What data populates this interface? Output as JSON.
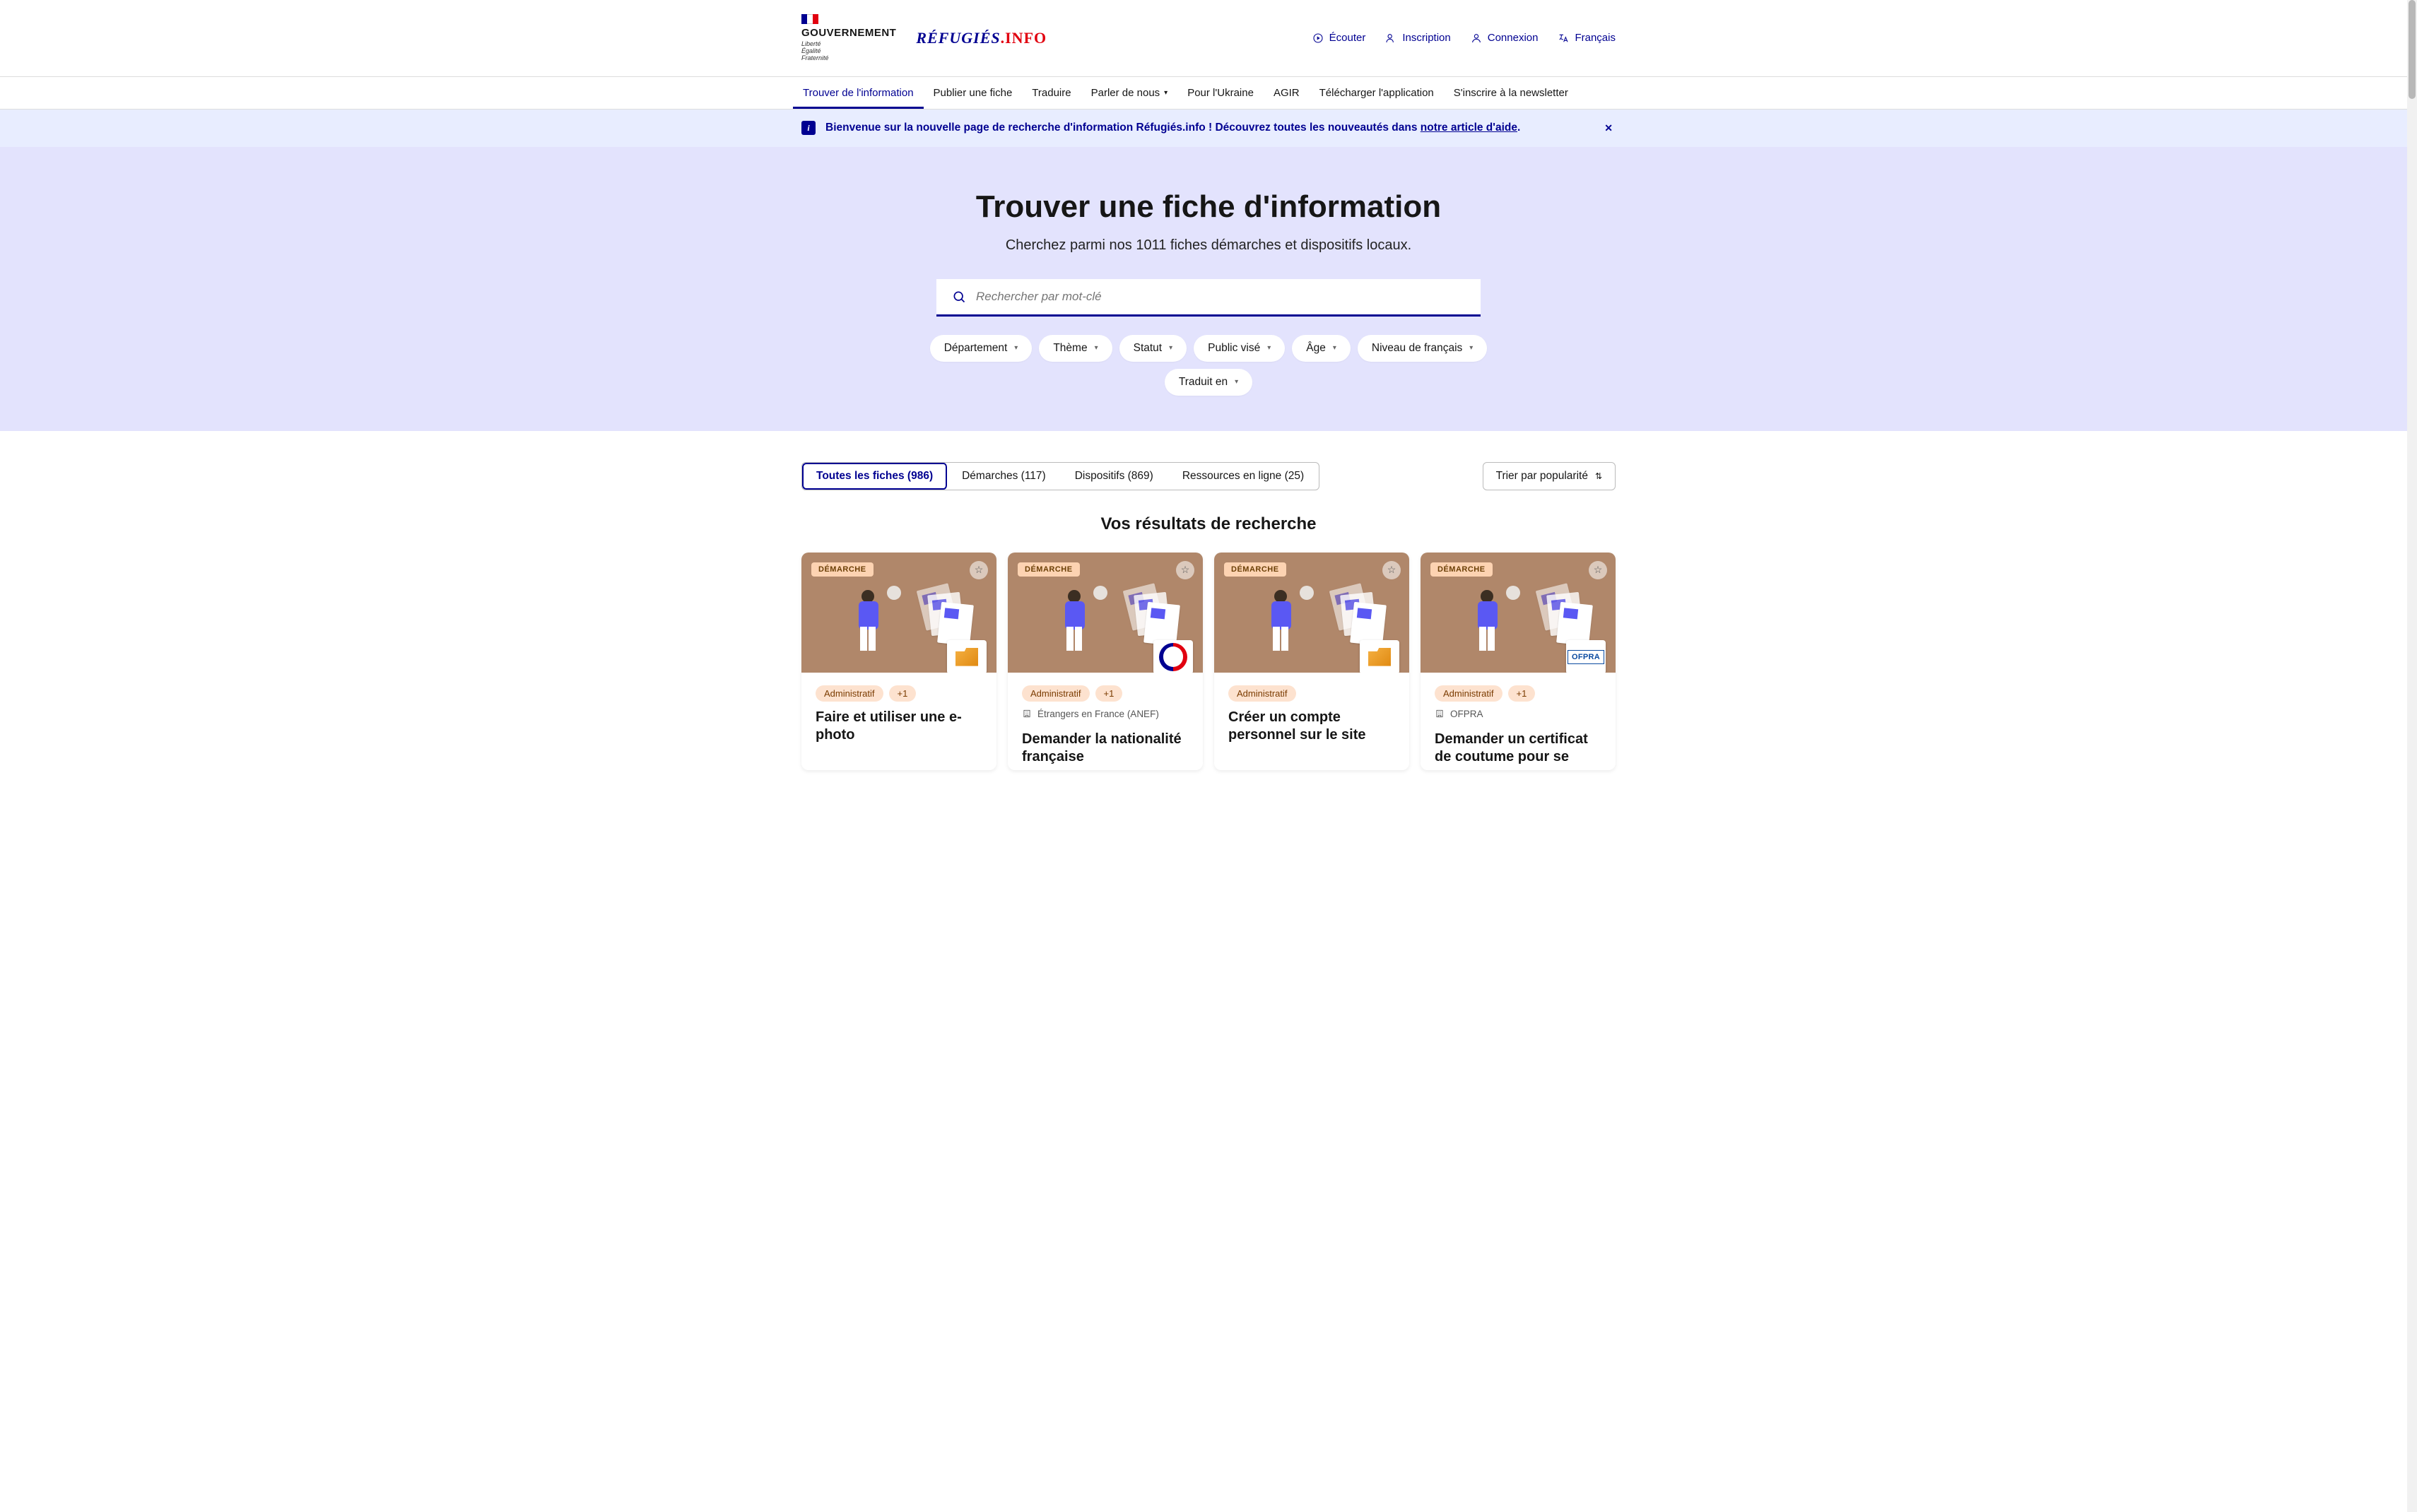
{
  "header": {
    "gov_word": "GOUVERNEMENT",
    "gov_motto": "Liberté\nÉgalité\nFraternité",
    "logo_a": "RÉFUGIÉS",
    "logo_b": ".INFO",
    "actions": {
      "listen": "Écouter",
      "register": "Inscription",
      "login": "Connexion",
      "language": "Français"
    }
  },
  "nav": {
    "find": "Trouver de l'information",
    "publish": "Publier une fiche",
    "translate": "Traduire",
    "talk": "Parler de nous",
    "ukraine": "Pour l'Ukraine",
    "agir": "AGIR",
    "download": "Télécharger l'application",
    "newsletter": "S'inscrire à la newsletter"
  },
  "banner": {
    "text_before": "Bienvenue sur la nouvelle page de recherche d'information Réfugiés.info ! Découvrez toutes les nouveautés dans ",
    "link": "notre article d'aide",
    "text_after": "."
  },
  "hero": {
    "title": "Trouver une fiche d'information",
    "subtitle": "Cherchez parmi nos 1011 fiches démarches et dispositifs locaux.",
    "search_placeholder": "Rechercher par mot-clé",
    "filters": {
      "department": "Département",
      "theme": "Thème",
      "status": "Statut",
      "audience": "Public visé",
      "age": "Âge",
      "french_level": "Niveau de français",
      "translated": "Traduit en"
    }
  },
  "tabs": {
    "all": "Toutes les fiches (986)",
    "steps": "Démarches (117)",
    "devices": "Dispositifs (869)",
    "online": "Ressources en ligne (25)"
  },
  "sort_label": "Trier par popularité",
  "results_heading": "Vos résultats de recherche",
  "card_badge": "DÉMARCHE",
  "tags": {
    "admin": "Administratif",
    "plus1": "+1"
  },
  "org_names": {
    "anef": "Étrangers en France (ANEF)",
    "ofpra": "OFPRA"
  },
  "cards": [
    {
      "title": "Faire et utiliser une e-photo",
      "org_logo": "folder",
      "tags": [
        "admin",
        "plus1"
      ]
    },
    {
      "title": "Demander la nationalité française",
      "org_logo": "marianne",
      "org_line": "anef",
      "tags": [
        "admin",
        "plus1"
      ]
    },
    {
      "title": "Créer un compte personnel sur le site",
      "org_logo": "folder",
      "tags": [
        "admin"
      ]
    },
    {
      "title": "Demander un certificat de coutume pour se",
      "org_logo": "ofpra",
      "org_line": "ofpra",
      "tags": [
        "admin",
        "plus1"
      ]
    }
  ]
}
